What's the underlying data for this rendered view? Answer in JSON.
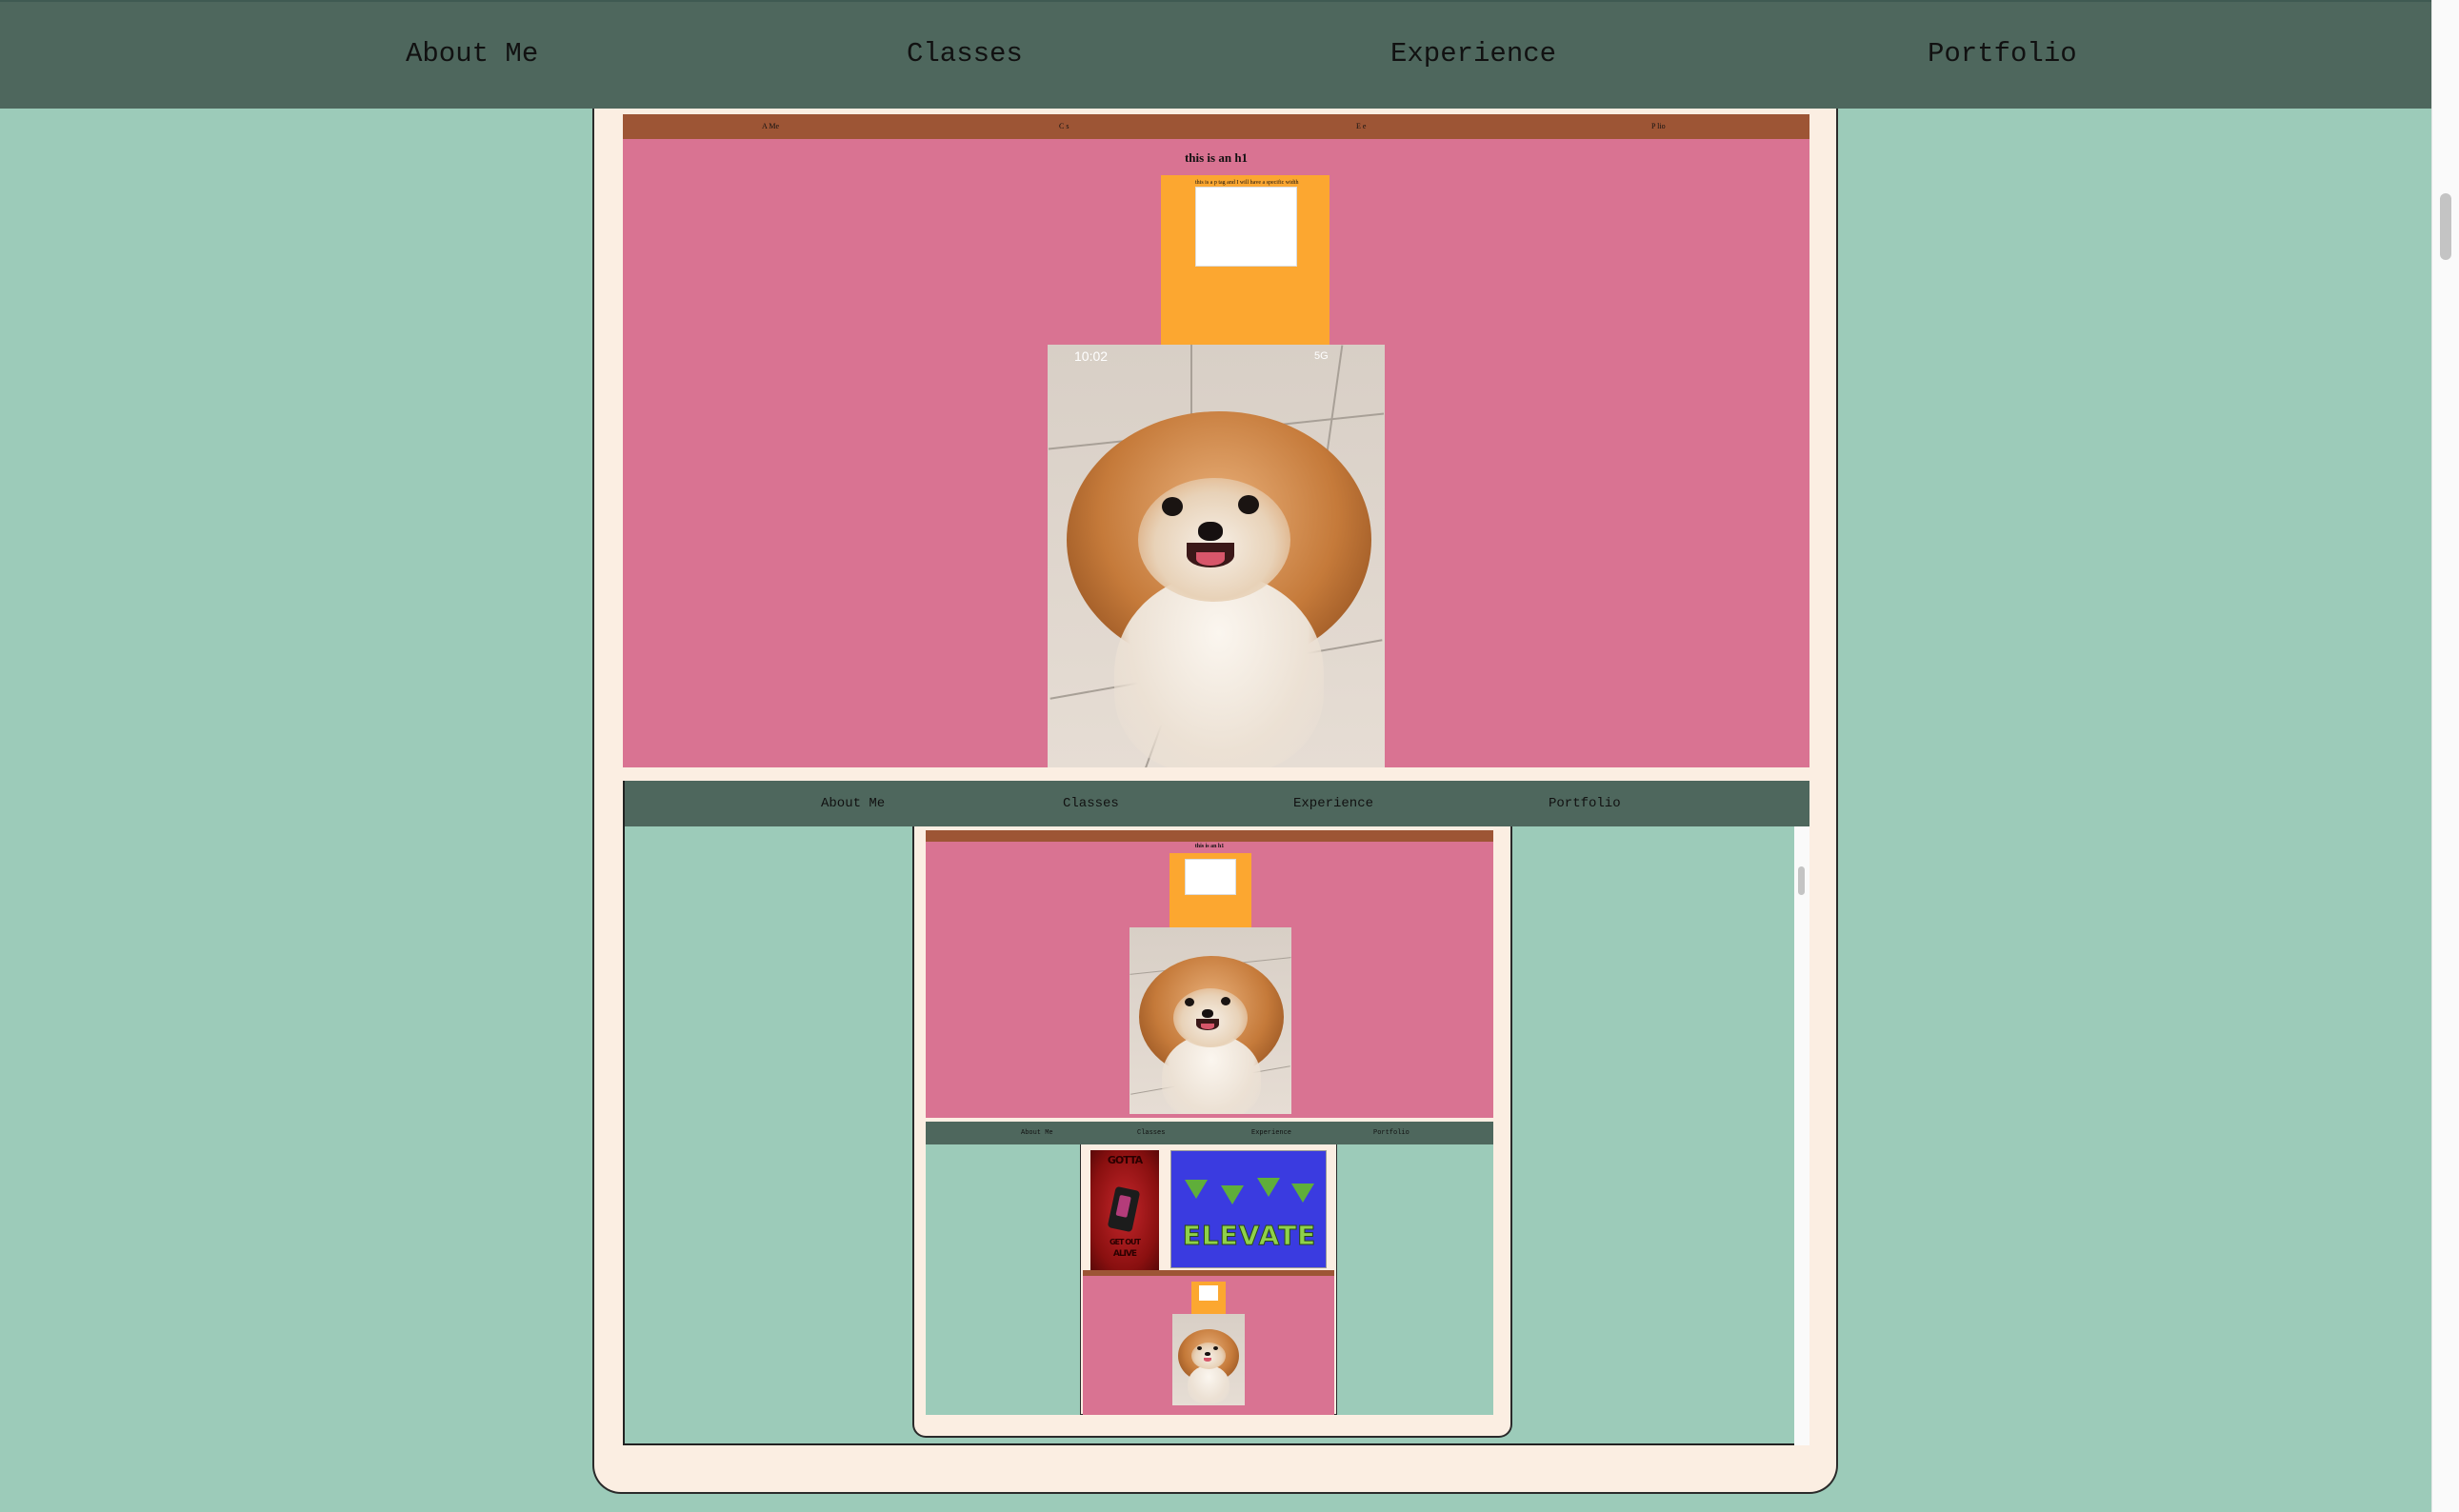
{
  "nav": {
    "items": [
      "About Me",
      "Classes",
      "Experience",
      "Portfolio"
    ]
  },
  "preview": {
    "small_nav": [
      "A Me",
      "C s",
      "E e",
      "P lio"
    ],
    "heading": "this is an h1",
    "paragraph": "this is a p tag and I will have a specific width",
    "status_time": "10:02",
    "status_right": "5G"
  },
  "level2": {
    "nav": [
      "About Me",
      "Classes",
      "Experience",
      "Portfolio"
    ],
    "heading": "this is an h1",
    "nav3": [
      "About Me",
      "Classes",
      "Experience",
      "Portfolio"
    ],
    "poster_red_top": "GOTTA",
    "poster_red_bottom": "GET OUT",
    "poster_red_bottom2": "ALIVE",
    "poster_blue_text": "ELEVATE"
  },
  "colors": {
    "background": "#9ccbb9",
    "nav": "#4e675d",
    "pink": "#d97392",
    "orange": "#fca730",
    "brown": "#9d5535",
    "card": "#fbeee2"
  }
}
